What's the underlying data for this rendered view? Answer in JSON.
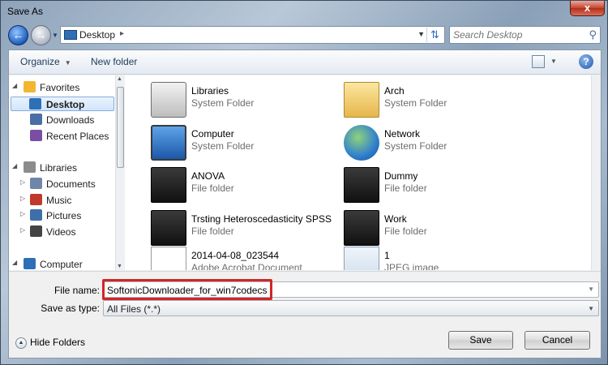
{
  "window": {
    "title": "Save As",
    "close_glyph": "x"
  },
  "nav": {
    "back_glyph": "←",
    "forward_glyph": "→",
    "address": "Desktop",
    "address_sep": "▸",
    "search_placeholder": "Search Desktop"
  },
  "toolbar": {
    "organize": "Organize",
    "new_folder": "New folder",
    "help": "?"
  },
  "sidebar": {
    "items": [
      {
        "label": "Favorites",
        "icon": "star-icon",
        "color": "#f2b632"
      },
      {
        "label": "Desktop",
        "icon": "desktop-icon",
        "color": "#2f6fb8"
      },
      {
        "label": "Downloads",
        "icon": "downloads-icon",
        "color": "#4a6fa5"
      },
      {
        "label": "Recent Places",
        "icon": "recent-places-icon",
        "color": "#7a4ea3"
      },
      {
        "label": "Libraries",
        "icon": "libraries-icon",
        "color": "#8c8c8c"
      },
      {
        "label": "Documents",
        "icon": "documents-icon",
        "color": "#6f86a8"
      },
      {
        "label": "Music",
        "icon": "music-icon",
        "color": "#c0392b"
      },
      {
        "label": "Pictures",
        "icon": "pictures-icon",
        "color": "#3e6fa8"
      },
      {
        "label": "Videos",
        "icon": "videos-icon",
        "color": "#444444"
      },
      {
        "label": "Computer",
        "icon": "computer-icon",
        "color": "#2f6fb8"
      }
    ]
  },
  "files": [
    {
      "name": "Libraries",
      "type": "System Folder",
      "icon": "libraries-icon"
    },
    {
      "name": "Arch",
      "type": "System Folder",
      "icon": "user-folder-icon"
    },
    {
      "name": "Computer",
      "type": "System Folder",
      "icon": "computer-icon"
    },
    {
      "name": "Network",
      "type": "System Folder",
      "icon": "network-icon"
    },
    {
      "name": "ANOVA",
      "type": "File folder",
      "icon": "folder-icon"
    },
    {
      "name": "Dummy",
      "type": "File folder",
      "icon": "folder-icon"
    },
    {
      "name": "Trsting Heteroscedasticity SPSS",
      "type": "File folder",
      "icon": "folder-icon"
    },
    {
      "name": "Work",
      "type": "File folder",
      "icon": "folder-icon"
    },
    {
      "name": "2014-04-08_023544",
      "type": "Adobe Acrobat Document",
      "icon": "pdf-document-icon"
    },
    {
      "name": "1",
      "type": "JPEG image",
      "icon": "jpeg-image-icon"
    }
  ],
  "form": {
    "file_name_label": "File name:",
    "file_name_value": "SoftonicDownloader_for_win7codecs",
    "save_type_label": "Save as type:",
    "save_type_value": "All Files (*.*)",
    "highlight_color": "#d22626"
  },
  "footer": {
    "hide_folders": "Hide Folders",
    "save": "Save",
    "cancel": "Cancel"
  }
}
